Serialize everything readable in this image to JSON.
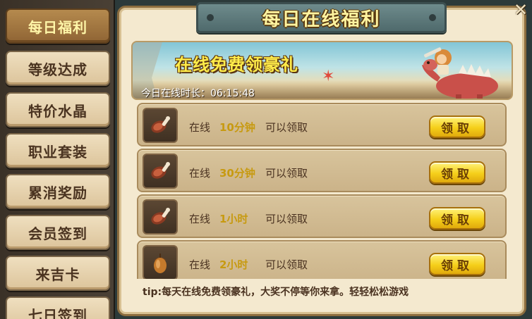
{
  "title": "每日在线福利",
  "close_glyph": "✕",
  "sidebar": {
    "items": [
      {
        "label": "每日福利",
        "active": true
      },
      {
        "label": "等级达成",
        "active": false
      },
      {
        "label": "特价水晶",
        "active": false
      },
      {
        "label": "职业套装",
        "active": false
      },
      {
        "label": "累消奖励",
        "active": false
      },
      {
        "label": "会员签到",
        "active": false
      },
      {
        "label": "来吉卡",
        "active": false
      },
      {
        "label": "七日签到",
        "active": false
      }
    ]
  },
  "banner": {
    "headline": "在线免费领豪礼",
    "online_label": "今日在线时长：",
    "online_time": "06:15:48"
  },
  "rewards": [
    {
      "prefix": "在线",
      "duration": "10分钟",
      "suffix": "可以领取",
      "button": "领取",
      "icon": "meat-icon"
    },
    {
      "prefix": "在线",
      "duration": "30分钟",
      "suffix": "可以领取",
      "button": "领取",
      "icon": "meat-icon"
    },
    {
      "prefix": "在线",
      "duration": "1小时",
      "suffix": "可以领取",
      "button": "领取",
      "icon": "meat-icon"
    },
    {
      "prefix": "在线",
      "duration": "2小时",
      "suffix": "可以领取",
      "button": "领取",
      "icon": "acorn-icon"
    }
  ],
  "tip": "tip:每天在线免费领豪礼，大奖不停等你来拿。轻轻松松游戏",
  "colors": {
    "accent_yellow": "#f5cf1a",
    "duration_text": "#c79a10",
    "panel_bg": "#f4e9cf",
    "title_plate": "#5c7879"
  }
}
